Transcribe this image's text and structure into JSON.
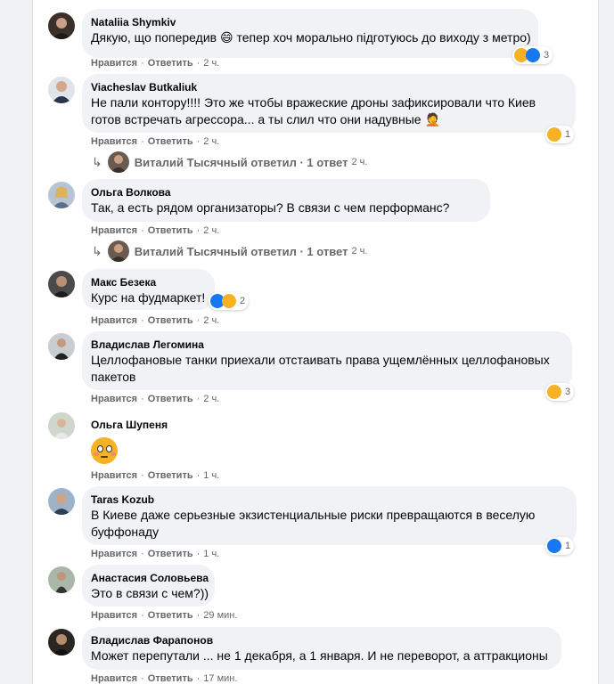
{
  "comments": [
    {
      "author": "Nataliia Shymkiv",
      "text": "Дякую, що попередив 😄 тепер хоч морально підготуюсь до виходу з метро)",
      "like_label": "Нравится",
      "reply_label": "Ответить",
      "time": "2 ч.",
      "reactions": [
        "haha-icon",
        "like-icon"
      ],
      "reaction_count": "3"
    },
    {
      "author": "Viacheslav Butkaliuk",
      "text_line1": "Не пали контору!!!! Это же чтобы вражеские дроны зафиксировали что Киев",
      "text_line2": "готов встречать агрессора... а ты слил что они надувные 🤦",
      "like_label": "Нравится",
      "reply_label": "Ответить",
      "time": "2 ч.",
      "reactions": [
        "haha-icon"
      ],
      "reaction_count": "1",
      "reply_summary": {
        "text": "Виталий Тысячный ответил · 1 ответ",
        "time": "2 ч."
      }
    },
    {
      "author": "Ольга Волкова",
      "text": "Так, а есть рядом организаторы? В связи с чем перформанс?",
      "like_label": "Нравится",
      "reply_label": "Ответить",
      "time": "2 ч.",
      "reply_summary": {
        "text": "Виталий Тысячный ответил · 1 ответ",
        "time": "2 ч."
      }
    },
    {
      "author": "Макс Безека",
      "text": "Курс на фудмаркет!",
      "like_label": "Нравится",
      "reply_label": "Ответить",
      "time": "2 ч.",
      "reactions": [
        "like-icon",
        "haha-icon"
      ],
      "reaction_count": "2"
    },
    {
      "author": "Владислав Легомина",
      "text_line1": "Целлофановые танки приехали отстаивать права ущемлённых целлофановых",
      "text_line2": "пакетов",
      "like_label": "Нравится",
      "reply_label": "Ответить",
      "time": "2 ч.",
      "reactions": [
        "haha-icon"
      ],
      "reaction_count": "3"
    },
    {
      "author": "Ольга Шупеня",
      "emoji": "flushed-face-emoji",
      "like_label": "Нравится",
      "reply_label": "Ответить",
      "time": "1 ч."
    },
    {
      "author": "Taras Kozub",
      "text_line1": "В Киеве даже серьезные экзистенциальные риски превращаются в веселую",
      "text_line2": "буффонаду",
      "like_label": "Нравится",
      "reply_label": "Ответить",
      "time": "1 ч.",
      "reactions": [
        "like-icon"
      ],
      "reaction_count": "1"
    },
    {
      "author": "Анастасия Соловьева",
      "text": "Это в связи с чем?))",
      "like_label": "Нравится",
      "reply_label": "Ответить",
      "time": "29 мин."
    },
    {
      "author": "Владислав Фарапонов",
      "text": "Может перепутали ... не 1 декабря, а 1 января. И не переворот, а аттракционы",
      "like_label": "Нравится",
      "reply_label": "Ответить",
      "time": "17 мин."
    }
  ],
  "colors": {
    "page_bg": "#f0f2f5",
    "bubble_bg": "#f0f2f5",
    "meta_text": "#65676b",
    "like_blue": "#1877f2",
    "haha_yellow": "#f7b125"
  }
}
